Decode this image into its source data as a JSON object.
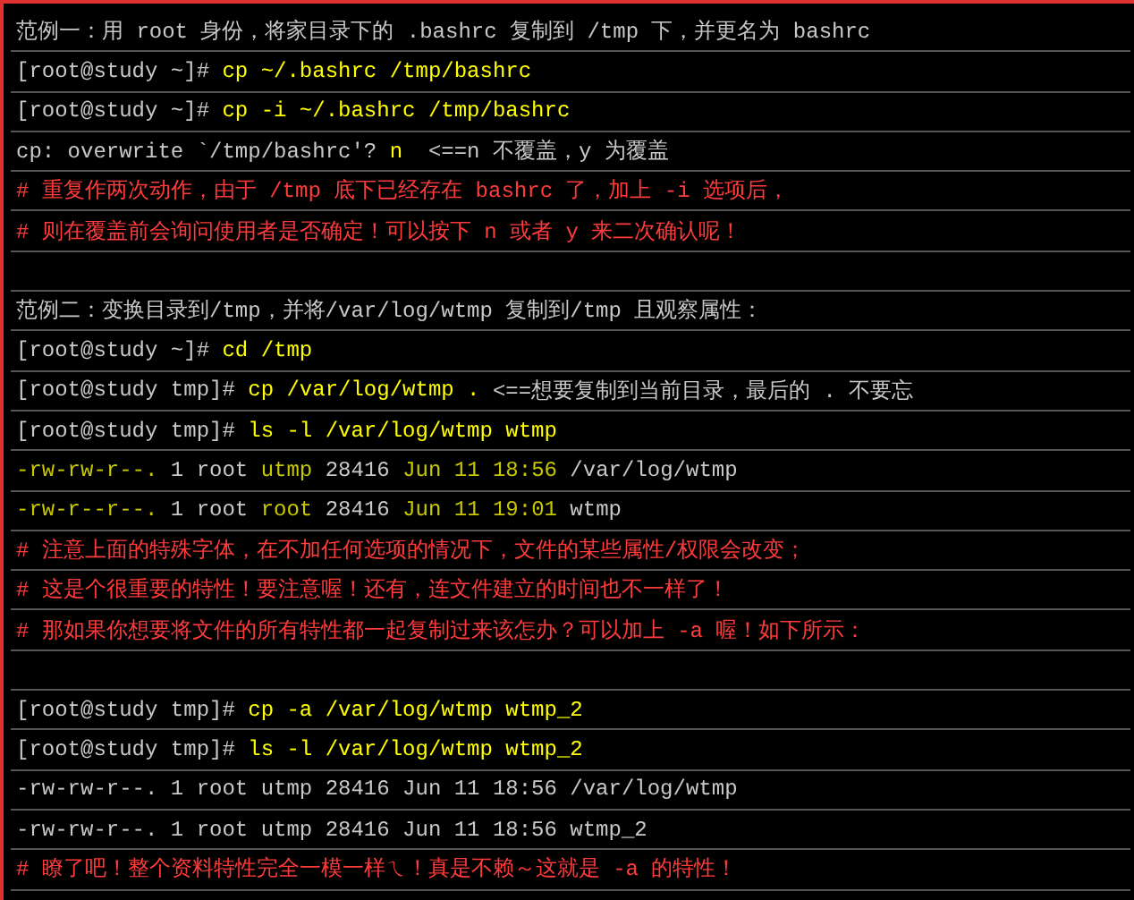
{
  "lines": [
    {
      "segments": [
        {
          "kind": "plain",
          "text": "范例一：用 root 身份，将家目录下的 .bashrc 复制到 /tmp 下，并更名为 bashrc"
        }
      ]
    },
    {
      "segments": [
        {
          "kind": "plain",
          "text": "[root@study ~]# "
        },
        {
          "kind": "command",
          "text": "cp ~/.bashrc /tmp/bashrc"
        }
      ]
    },
    {
      "segments": [
        {
          "kind": "plain",
          "text": "[root@study ~]# "
        },
        {
          "kind": "command",
          "text": "cp -i ~/.bashrc /tmp/bashrc"
        }
      ]
    },
    {
      "segments": [
        {
          "kind": "plain",
          "text": "cp: overwrite `/tmp/bashrc'? "
        },
        {
          "kind": "command",
          "text": "n"
        },
        {
          "kind": "plain",
          "text": "  <==n 不覆盖，y 为覆盖"
        }
      ]
    },
    {
      "segments": [
        {
          "kind": "comment",
          "text": "# 重复作两次动作，由于 /tmp 底下已经存在 bashrc 了，加上 -i 选项后，"
        }
      ]
    },
    {
      "segments": [
        {
          "kind": "comment",
          "text": "# 则在覆盖前会询问使用者是否确定！可以按下 n 或者 y 来二次确认呢！"
        }
      ]
    },
    {
      "kind": "blank"
    },
    {
      "segments": [
        {
          "kind": "plain",
          "text": "范例二：变换目录到/tmp，并将/var/log/wtmp 复制到/tmp 且观察属性："
        }
      ]
    },
    {
      "segments": [
        {
          "kind": "plain",
          "text": "[root@study ~]# "
        },
        {
          "kind": "command",
          "text": "cd /tmp"
        }
      ]
    },
    {
      "segments": [
        {
          "kind": "plain",
          "text": "[root@study tmp]# "
        },
        {
          "kind": "command",
          "text": "cp /var/log/wtmp ."
        },
        {
          "kind": "plain",
          "text": " <==想要复制到当前目录，最后的 . 不要忘"
        }
      ]
    },
    {
      "segments": [
        {
          "kind": "plain",
          "text": "[root@study tmp]# "
        },
        {
          "kind": "command",
          "text": "ls -l /var/log/wtmp wtmp"
        }
      ]
    },
    {
      "segments": [
        {
          "kind": "field",
          "text": "-rw-rw-r--."
        },
        {
          "kind": "plain",
          "text": " 1 root "
        },
        {
          "kind": "field",
          "text": "utmp"
        },
        {
          "kind": "plain",
          "text": " 28416 "
        },
        {
          "kind": "field",
          "text": "Jun 11 18:56"
        },
        {
          "kind": "plain",
          "text": " /var/log/wtmp"
        }
      ]
    },
    {
      "segments": [
        {
          "kind": "field",
          "text": "-rw-r--r--."
        },
        {
          "kind": "plain",
          "text": " 1 root "
        },
        {
          "kind": "field",
          "text": "root"
        },
        {
          "kind": "plain",
          "text": " 28416 "
        },
        {
          "kind": "field",
          "text": "Jun 11 19:01"
        },
        {
          "kind": "plain",
          "text": " wtmp"
        }
      ]
    },
    {
      "segments": [
        {
          "kind": "comment",
          "text": "# 注意上面的特殊字体，在不加任何选项的情况下，文件的某些属性/权限会改变；"
        }
      ]
    },
    {
      "segments": [
        {
          "kind": "comment",
          "text": "# 这是个很重要的特性！要注意喔！还有，连文件建立的时间也不一样了！"
        }
      ]
    },
    {
      "segments": [
        {
          "kind": "comment",
          "text": "# 那如果你想要将文件的所有特性都一起复制过来该怎办？可以加上 -a 喔！如下所示："
        }
      ]
    },
    {
      "kind": "blank"
    },
    {
      "segments": [
        {
          "kind": "plain",
          "text": "[root@study tmp]# "
        },
        {
          "kind": "command",
          "text": "cp -a /var/log/wtmp wtmp_2"
        }
      ]
    },
    {
      "segments": [
        {
          "kind": "plain",
          "text": "[root@study tmp]# "
        },
        {
          "kind": "command",
          "text": "ls -l /var/log/wtmp wtmp_2"
        }
      ]
    },
    {
      "segments": [
        {
          "kind": "plain",
          "text": "-rw-rw-r--. 1 root utmp 28416 Jun 11 18:56 /var/log/wtmp"
        }
      ]
    },
    {
      "segments": [
        {
          "kind": "plain",
          "text": "-rw-rw-r--. 1 root utmp 28416 Jun 11 18:56 wtmp_2"
        }
      ]
    },
    {
      "segments": [
        {
          "kind": "comment",
          "text": "# 瞭了吧！整个资料特性完全一模一样ㄟ！真是不赖～这就是 -a 的特性！"
        }
      ]
    }
  ]
}
